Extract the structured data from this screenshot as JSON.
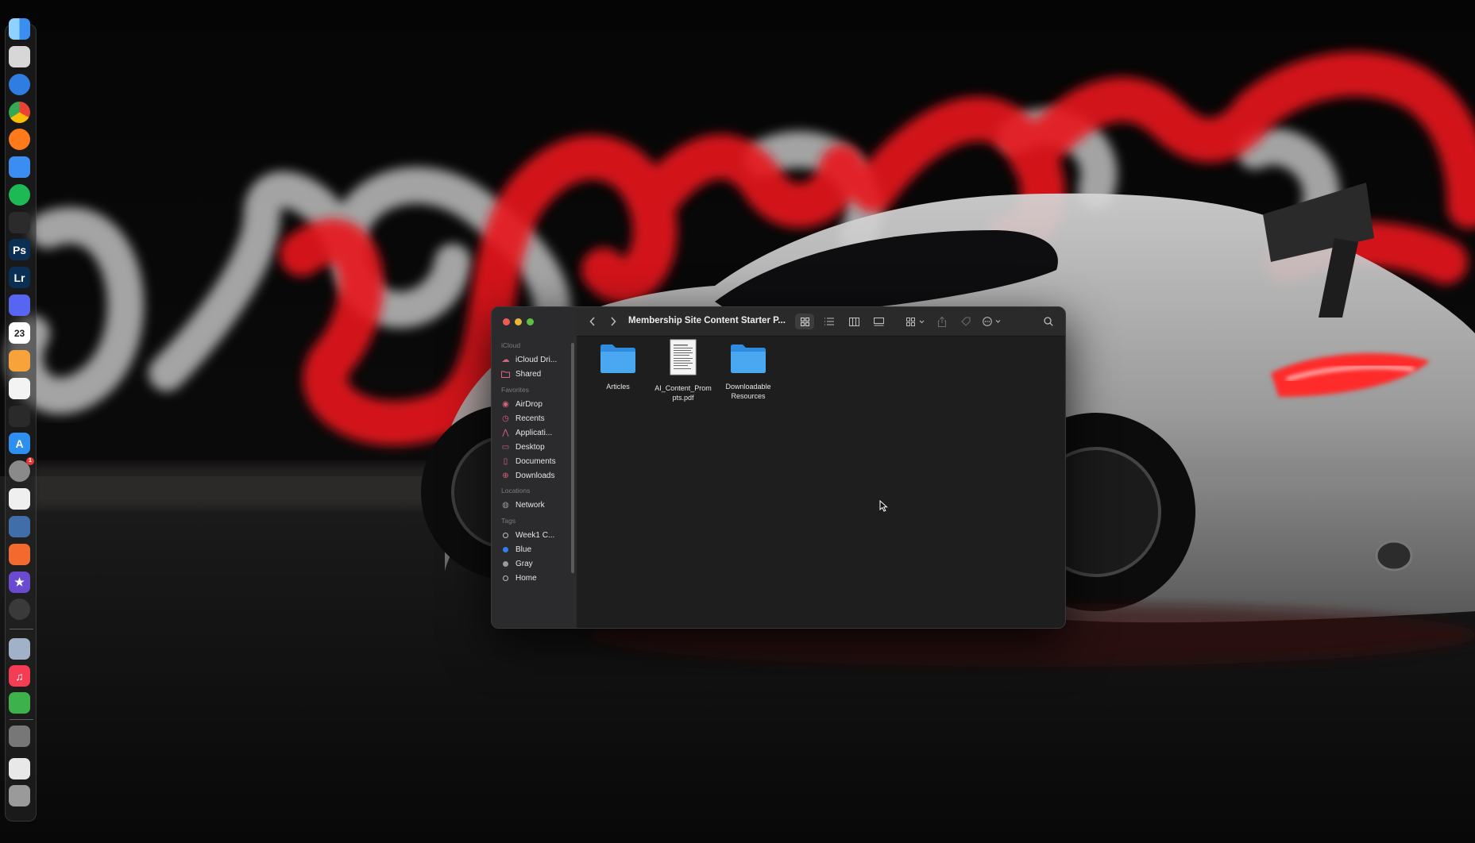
{
  "dock": {
    "items": [
      {
        "name": "Finder",
        "icon": "finder-icon",
        "color": "#3a8ef0"
      },
      {
        "name": "Launchpad",
        "icon": "launchpad-icon",
        "color": "#d7d7d7"
      },
      {
        "name": "Safari",
        "icon": "safari-icon",
        "color": "#2f7de1"
      },
      {
        "name": "Chrome",
        "icon": "chrome-icon",
        "color": "#e8e8e8"
      },
      {
        "name": "Firefox",
        "icon": "firefox-icon",
        "color": "#ff7a1a"
      },
      {
        "name": "Mail",
        "icon": "mail-icon",
        "color": "#3c8df2"
      },
      {
        "name": "Spotify",
        "icon": "spotify-icon",
        "color": "#1db954"
      },
      {
        "name": "ChatGPT",
        "icon": "chatgpt-icon",
        "color": "#2b2b2b"
      },
      {
        "name": "Photoshop",
        "icon": "photoshop-icon",
        "label": "Ps",
        "color": "#0b2e54"
      },
      {
        "name": "Lightroom",
        "icon": "lightroom-icon",
        "label": "Lr",
        "color": "#0b2e54"
      },
      {
        "name": "Discord",
        "icon": "discord-icon",
        "color": "#5865f2"
      },
      {
        "name": "Calendar",
        "icon": "calendar-icon",
        "label": "23",
        "color": "#ffffff"
      },
      {
        "name": "Pages",
        "icon": "pages-icon",
        "color": "#f7a33a"
      },
      {
        "name": "Notes",
        "icon": "notes-icon",
        "color": "#f3f3f3"
      },
      {
        "name": "Perplexity",
        "icon": "perplexity-icon",
        "color": "#2a2a2a"
      },
      {
        "name": "App Store",
        "icon": "app-store-icon",
        "label": "A",
        "color": "#2d8ff0"
      },
      {
        "name": "System Settings",
        "icon": "settings-icon",
        "color": "#8a8a8a",
        "badge": "1"
      },
      {
        "name": "Script Editor",
        "icon": "script-editor-icon",
        "color": "#efefef"
      },
      {
        "name": "Proxyman",
        "icon": "proxyman-icon",
        "color": "#3f6ea8"
      },
      {
        "name": "Cube App",
        "icon": "cube-icon",
        "color": "#f26a2e"
      },
      {
        "name": "iMovie",
        "icon": "imovie-icon",
        "label": "★",
        "color": "#6a4bd0"
      },
      {
        "name": "OBS",
        "icon": "obs-icon",
        "color": "#3a3a3a"
      },
      {
        "name": "Preview",
        "icon": "preview-icon",
        "color": "#9fb2c8"
      },
      {
        "name": "Music",
        "icon": "music-icon",
        "label": "♫",
        "color": "#f43c55"
      },
      {
        "name": "Numbers",
        "icon": "numbers-icon",
        "color": "#3db14a"
      },
      {
        "name": "Recent Screenshot",
        "icon": "screenshot-thumbnail-icon",
        "color": "#777777"
      },
      {
        "name": "Recent Document",
        "icon": "document-thumbnail-icon",
        "color": "#e8e8e8"
      },
      {
        "name": "Trash",
        "icon": "trash-icon",
        "color": "#9a9a9a"
      }
    ]
  },
  "finder": {
    "title": "Membership Site Content Starter P...",
    "sidebar": {
      "icloud_header": "iCloud",
      "icloud_items": [
        {
          "label": "iCloud Dri...",
          "icon": "cloud-icon"
        },
        {
          "label": "Shared",
          "icon": "shared-folder-icon"
        }
      ],
      "favorites_header": "Favorites",
      "favorites_items": [
        {
          "label": "AirDrop",
          "icon": "airdrop-icon"
        },
        {
          "label": "Recents",
          "icon": "clock-icon"
        },
        {
          "label": "Applicati...",
          "icon": "applications-icon"
        },
        {
          "label": "Desktop",
          "icon": "desktop-icon"
        },
        {
          "label": "Documents",
          "icon": "document-icon"
        },
        {
          "label": "Downloads",
          "icon": "download-icon"
        }
      ],
      "locations_header": "Locations",
      "locations_items": [
        {
          "label": "Network",
          "icon": "network-icon"
        }
      ],
      "tags_header": "Tags",
      "tags": [
        {
          "label": "Week1 C...",
          "color": "none"
        },
        {
          "label": "Blue",
          "color": "#2f7ff3"
        },
        {
          "label": "Gray",
          "color": "#9a9a9a"
        },
        {
          "label": "Home",
          "color": "none"
        }
      ]
    },
    "files": [
      {
        "name": "Articles",
        "type": "folder"
      },
      {
        "name": "AI_Content_Prompts.pdf",
        "line1": "AI_Content_Prom",
        "line2": "pts.pdf",
        "type": "pdf"
      },
      {
        "name": "Downloadable Resources",
        "line1": "Downloadable",
        "line2": "Resources",
        "type": "folder"
      }
    ]
  },
  "colors": {
    "light_trail_red": "#e8121d",
    "light_trail_white": "#d8d8d8",
    "folder_blue": "#4aa8f0"
  }
}
